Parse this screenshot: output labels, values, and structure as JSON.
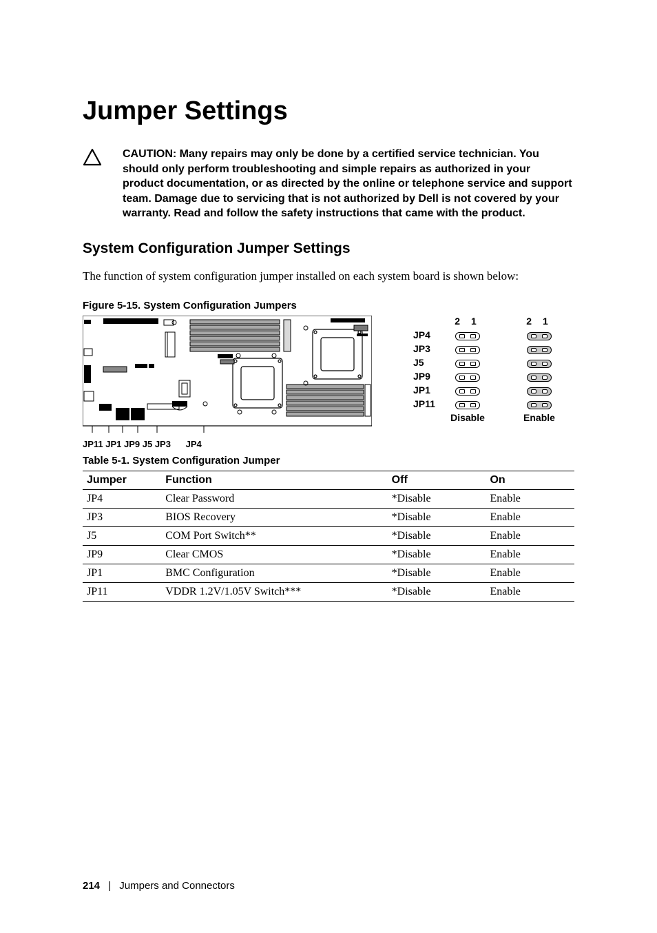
{
  "title": "Jumper Settings",
  "caution": "CAUTION: Many repairs may only be done by a certified service technician. You should only perform troubleshooting and simple repairs as authorized in your product documentation, or as directed by the online or telephone service and support team. Damage due to servicing that is not authorized by Dell is not covered by your warranty. Read and follow the safety instructions that came with the product.",
  "subheading": "System Configuration Jumper Settings",
  "body_text": "The function of system configuration jumper installed on each system board is shown below:",
  "figure_caption": "Figure 5-15.   System Configuration Jumpers",
  "board_labels_left": "JP11 JP1 JP9 J5 JP3",
  "board_labels_right": "JP4",
  "legend": {
    "pin_header": "2   1",
    "rows": [
      "JP4",
      "JP3",
      "J5",
      "JP9",
      "JP1",
      "JP11"
    ],
    "disable_label": "Disable",
    "enable_label": "Enable"
  },
  "table_caption": "Table 5-1.   System Configuration Jumper",
  "table": {
    "headers": [
      "Jumper",
      "Function",
      "Off",
      "On"
    ],
    "rows": [
      [
        "JP4",
        "Clear Password",
        "*Disable",
        "Enable"
      ],
      [
        "JP3",
        "BIOS Recovery",
        "*Disable",
        "Enable"
      ],
      [
        "J5",
        "COM Port Switch**",
        "*Disable",
        "Enable"
      ],
      [
        "JP9",
        "Clear CMOS",
        "*Disable",
        "Enable"
      ],
      [
        "JP1",
        "BMC Configuration",
        "*Disable",
        "Enable"
      ],
      [
        "JP11",
        "VDDR 1.2V/1.05V Switch***",
        "*Disable",
        "Enable"
      ]
    ]
  },
  "footer": {
    "page": "214",
    "section": "Jumpers and Connectors"
  }
}
